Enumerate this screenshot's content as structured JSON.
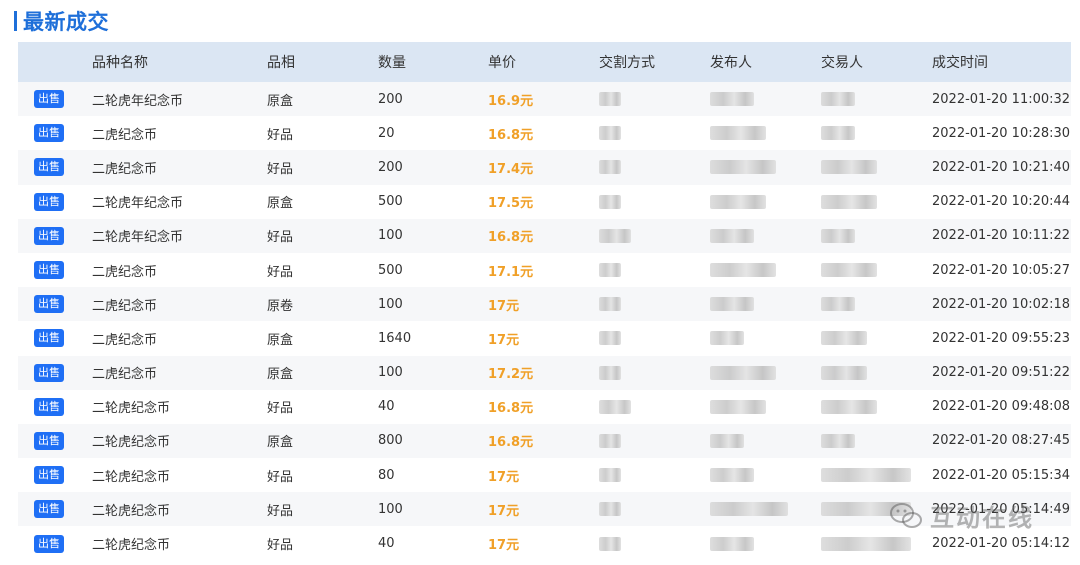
{
  "section": {
    "title": "最新成交"
  },
  "columns": [
    "",
    "品种名称",
    "品相",
    "数量",
    "单价",
    "交割方式",
    "发布人",
    "交易人",
    "成交时间"
  ],
  "rows": [
    {
      "type": "出售",
      "name": "二轮虎年纪念币",
      "grade": "原盒",
      "qty": "200",
      "price": "16.9元",
      "time": "2022-01-20 11:00:32"
    },
    {
      "type": "出售",
      "name": "二虎纪念币",
      "grade": "好品",
      "qty": "20",
      "price": "16.8元",
      "time": "2022-01-20 10:28:30"
    },
    {
      "type": "出售",
      "name": "二虎纪念币",
      "grade": "好品",
      "qty": "200",
      "price": "17.4元",
      "time": "2022-01-20 10:21:40"
    },
    {
      "type": "出售",
      "name": "二轮虎年纪念币",
      "grade": "原盒",
      "qty": "500",
      "price": "17.5元",
      "time": "2022-01-20 10:20:44"
    },
    {
      "type": "出售",
      "name": "二轮虎年纪念币",
      "grade": "好品",
      "qty": "100",
      "price": "16.8元",
      "time": "2022-01-20 10:11:22"
    },
    {
      "type": "出售",
      "name": "二虎纪念币",
      "grade": "好品",
      "qty": "500",
      "price": "17.1元",
      "time": "2022-01-20 10:05:27"
    },
    {
      "type": "出售",
      "name": "二虎纪念币",
      "grade": "原卷",
      "qty": "100",
      "price": "17元",
      "time": "2022-01-20 10:02:18"
    },
    {
      "type": "出售",
      "name": "二虎纪念币",
      "grade": "原盒",
      "qty": "1640",
      "price": "17元",
      "time": "2022-01-20 09:55:23"
    },
    {
      "type": "出售",
      "name": "二虎纪念币",
      "grade": "原盒",
      "qty": "100",
      "price": "17.2元",
      "time": "2022-01-20 09:51:22"
    },
    {
      "type": "出售",
      "name": "二轮虎纪念币",
      "grade": "好品",
      "qty": "40",
      "price": "16.8元",
      "time": "2022-01-20 09:48:08"
    },
    {
      "type": "出售",
      "name": "二轮虎纪念币",
      "grade": "原盒",
      "qty": "800",
      "price": "16.8元",
      "time": "2022-01-20 08:27:45"
    },
    {
      "type": "出售",
      "name": "二轮虎纪念币",
      "grade": "好品",
      "qty": "80",
      "price": "17元",
      "time": "2022-01-20 05:15:34"
    },
    {
      "type": "出售",
      "name": "二轮虎纪念币",
      "grade": "好品",
      "qty": "100",
      "price": "17元",
      "time": "2022-01-20 05:14:49"
    },
    {
      "type": "出售",
      "name": "二轮虎纪念币",
      "grade": "好品",
      "qty": "40",
      "price": "17元",
      "time": "2022-01-20 05:14:12"
    }
  ],
  "watermark": {
    "text": "互动在线",
    "icon": "wechat-icon"
  },
  "colors": {
    "accent": "#1e6fd9",
    "badge": "#1f6ff5",
    "price": "#f0a028",
    "header_bg": "#dbe6f3"
  }
}
